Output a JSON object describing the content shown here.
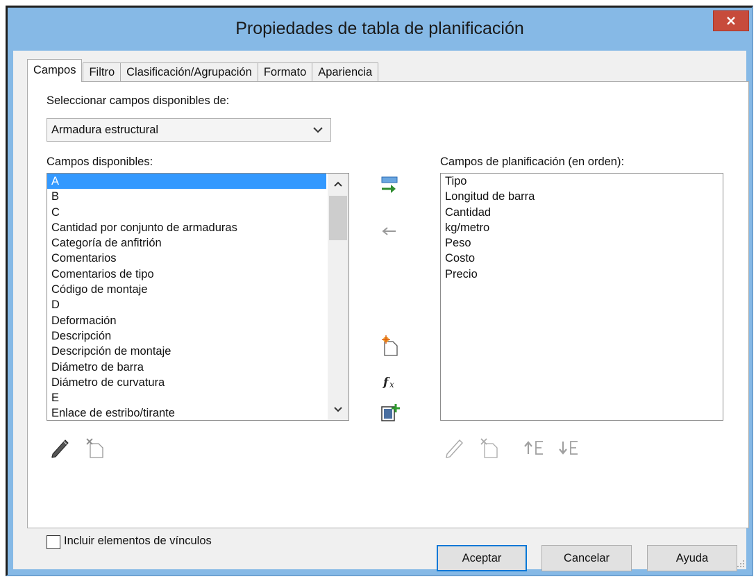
{
  "window": {
    "title": "Propiedades de tabla de planificación"
  },
  "tabs": [
    {
      "label": "Campos",
      "active": true
    },
    {
      "label": "Filtro",
      "active": false
    },
    {
      "label": "Clasificación/Agrupación",
      "active": false
    },
    {
      "label": "Formato",
      "active": false
    },
    {
      "label": "Apariencia",
      "active": false
    }
  ],
  "select_fields_from": {
    "label": "Seleccionar campos disponibles de:",
    "value": "Armadura estructural"
  },
  "available_fields": {
    "label": "Campos disponibles:",
    "items": [
      "A",
      "B",
      "C",
      "Cantidad por conjunto de armaduras",
      "Categoría de anfitrión",
      "Comentarios",
      "Comentarios de tipo",
      "Código de montaje",
      "D",
      "Deformación",
      "Descripción",
      "Descripción de montaje",
      "Diámetro de barra",
      "Diámetro de curvatura",
      "E",
      "Enlace de estribo/tirante"
    ],
    "selected_index": 0
  },
  "scheduled_fields": {
    "label": "Campos de planificación (en orden):",
    "items": [
      "Tipo",
      "Longitud de barra",
      "Cantidad",
      "kg/metro",
      "Peso",
      "Costo",
      "Precio"
    ]
  },
  "include_links": {
    "label": "Incluir elementos de vínculos",
    "checked": false
  },
  "buttons": {
    "ok": "Aceptar",
    "cancel": "Cancelar",
    "help": "Ayuda"
  },
  "icons": {
    "close": "close-icon",
    "add_field": "add-field-icon",
    "remove_field": "remove-field-icon",
    "new_parameter": "new-parameter-icon",
    "calculated_value": "fx-icon",
    "combine_parameters": "combine-parameters-icon",
    "edit": "pencil-icon",
    "delete": "delete-parameter-icon",
    "move_up": "move-up-icon",
    "move_down": "move-down-icon"
  },
  "colors": {
    "titlebar": "#86b9e6",
    "close_button": "#c74b3b",
    "selection": "#3399ff",
    "default_button_border": "#0078d7"
  }
}
